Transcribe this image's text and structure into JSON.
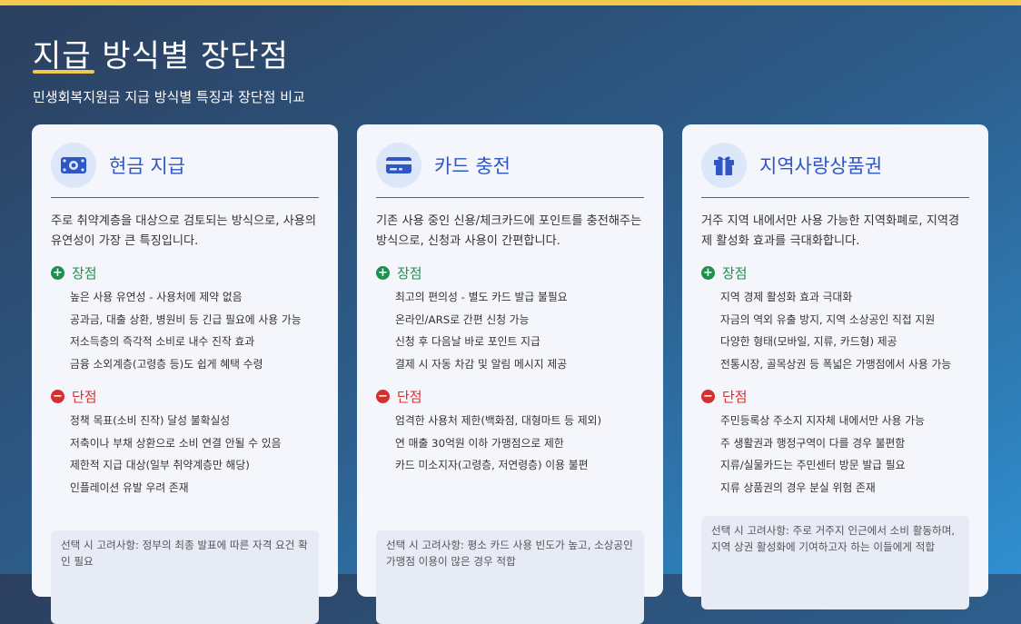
{
  "page": {
    "title": "지급 방식별 장단점",
    "subtitle": "민생회복지원금 지급 방식별 특징과 장단점 비교"
  },
  "colors": {
    "accent": "#f2c94c",
    "card_title": "#2f56c4",
    "pros": "#1f8f4e",
    "cons": "#d62f2f"
  },
  "cards": [
    {
      "icon": "money-icon",
      "title": "현금 지급",
      "description": "주로 취약계층을 대상으로 검토되는 방식으로, 사용의 유연성이 가장 큰 특징입니다.",
      "pros_title": "장점",
      "pros": [
        "높은 사용 유연성 - 사용처에 제약 없음",
        "공과금, 대출 상환, 병원비 등 긴급 필요에 사용 가능",
        "저소득층의 즉각적 소비로 내수 진작 효과",
        "금융 소외계층(고령층 등)도 쉽게 혜택 수령"
      ],
      "cons_title": "단점",
      "cons": [
        "정책 목표(소비 진작) 달성 불확실성",
        "저축이나 부채 상환으로 소비 연결 안될 수 있음",
        "제한적 지급 대상(일부 취약계층만 해당)",
        "인플레이션 유발 우려 존재"
      ],
      "consideration": "선택 시 고려사항: 정부의 최종 발표에 따른 자격 요건 확인 필요"
    },
    {
      "icon": "credit-card-icon",
      "title": "카드 충전",
      "description": "기존 사용 중인 신용/체크카드에 포인트를 충전해주는 방식으로, 신청과 사용이 간편합니다.",
      "pros_title": "장점",
      "pros": [
        "최고의 편의성 - 별도 카드 발급 불필요",
        "온라인/ARS로 간편 신청 가능",
        "신청 후 다음날 바로 포인트 지급",
        "결제 시 자동 차감 및 알림 메시지 제공"
      ],
      "cons_title": "단점",
      "cons": [
        "엄격한 사용처 제한(백화점, 대형마트 등 제외)",
        "연 매출 30억원 이하 가맹점으로 제한",
        "카드 미소지자(고령층, 저연령층) 이용 불편"
      ],
      "consideration": "선택 시 고려사항: 평소 카드 사용 빈도가 높고, 소상공인 가맹점 이용이 많은 경우 적합"
    },
    {
      "icon": "gift-icon",
      "title": "지역사랑상품권",
      "description": "거주 지역 내에서만 사용 가능한 지역화폐로, 지역경제 활성화 효과를 극대화합니다.",
      "pros_title": "장점",
      "pros": [
        "지역 경제 활성화 효과 극대화",
        "자금의 역외 유출 방지, 지역 소상공인 직접 지원",
        "다양한 형태(모바일, 지류, 카드형) 제공",
        "전통시장, 골목상권 등 폭넓은 가맹점에서 사용 가능"
      ],
      "cons_title": "단점",
      "cons": [
        "주민등록상 주소지 지자체 내에서만 사용 가능",
        "주 생활권과 행정구역이 다를 경우 불편함",
        "지류/실물카드는 주민센터 방문 발급 필요",
        "지류 상품권의 경우 분실 위험 존재"
      ],
      "consideration": "선택 시 고려사항: 주로 거주지 인근에서 소비 활동하며, 지역 상권 활성화에 기여하고자 하는 이들에게 적합"
    }
  ]
}
